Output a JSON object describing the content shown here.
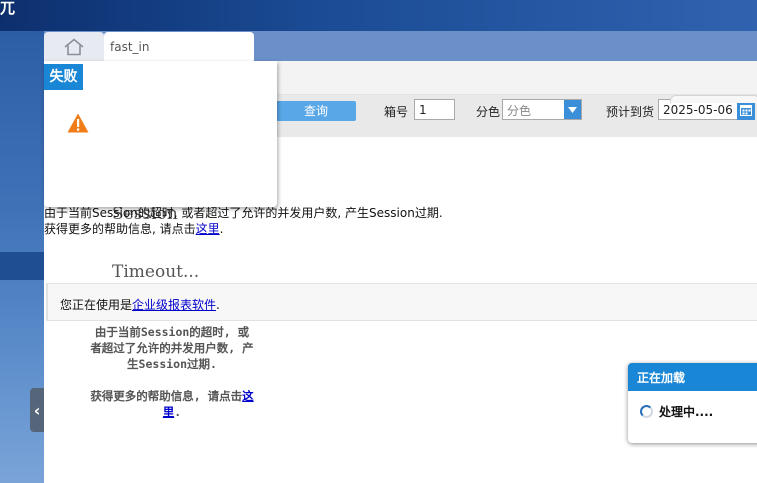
{
  "app": {
    "brand_fragment": "兀"
  },
  "tabs": [
    {
      "icon": "home-icon",
      "label": ""
    },
    {
      "label": "fast_in"
    }
  ],
  "toolbar": {
    "query_label": "查询",
    "box_no_label": "箱号",
    "box_no_value": "1",
    "color_label": "分色",
    "color_selected": "分色",
    "expected_label": "预计到货",
    "expected_value": "2025-05-06"
  },
  "error": {
    "title_line1": "Session",
    "title_line2": "Timeout...",
    "message": "由于当前Session的超时, 或者超过了允许的并发用户数, 产生Session过期.",
    "help_prefix": "获得更多的帮助信息, 请点击",
    "help_link": "这里",
    "help_suffix": ".",
    "enterprise_prefix": "您正在使用是",
    "enterprise_link": "企业级报表软件",
    "enterprise_suffix": ".",
    "mono_message": "由于当前Session的超时, 或者超过了允许的并发用户数, 产生Session过期.",
    "mono_help_prefix": "获得更多的帮助信息, 请点击",
    "mono_help_link": "这里",
    "mono_help_suffix": "."
  },
  "fail_dialog": {
    "title": "失败",
    "icon": "warning-icon"
  },
  "loading_dialog": {
    "title": "正在加载",
    "message": "处理中...."
  },
  "colors": {
    "accent": "#1a86d6",
    "button": "#5aa7e7",
    "warning": "#f07d17"
  }
}
